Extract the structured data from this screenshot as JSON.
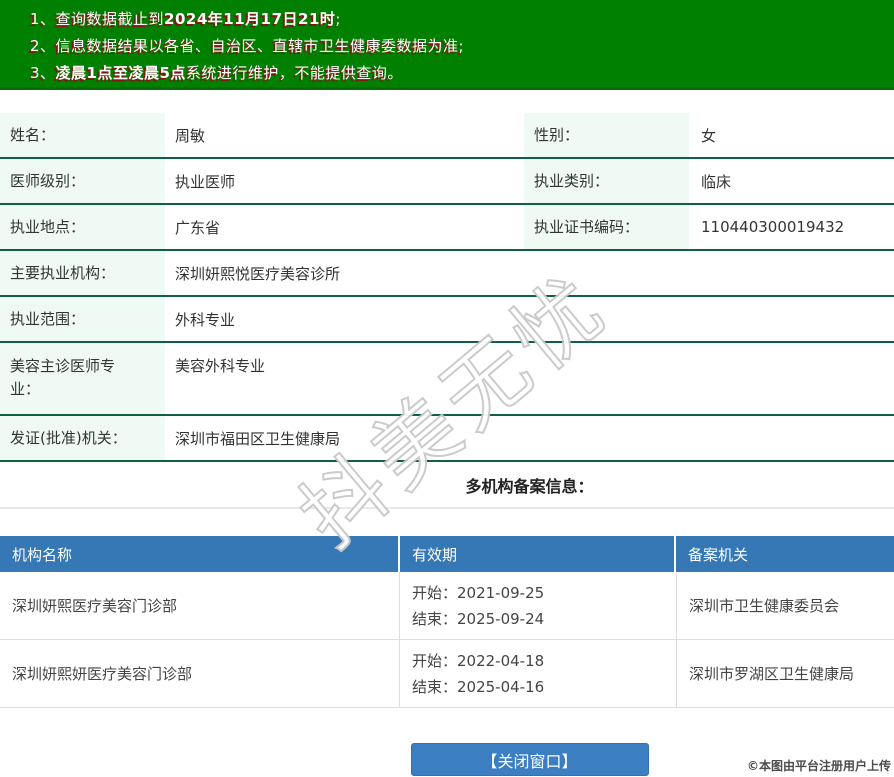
{
  "banner": {
    "bg_color": "#008000",
    "text_color": "#ffffff",
    "shadow_color": "#7b1a0e",
    "notices": [
      {
        "pre": "1、查询数据截止到",
        "bold": "2024年11月17日21时",
        "post": ";"
      },
      {
        "pre": "2、信息数据结果以各省、自治区、直辖市卫生健康委数据为准;",
        "bold": "",
        "post": ""
      },
      {
        "pre": "3、",
        "bold": "凌晨1点至凌晨5点",
        "post": "系统进行维护，不能提供查询。"
      }
    ]
  },
  "profile": {
    "name_label": "姓名：",
    "name_value": "周敏",
    "gender_label": "性别：",
    "gender_value": "女",
    "level_label": "医师级别：",
    "level_value": "执业医师",
    "category_label": "执业类别：",
    "category_value": "临床",
    "location_label": "执业地点：",
    "location_value": "广东省",
    "cert_label": "执业证书编码：",
    "cert_value": "110440300019432",
    "org_label": "主要执业机构：",
    "org_value": "深圳妍熙悦医疗美容诊所",
    "scope_label": "执业范围：",
    "scope_value": "外科专业",
    "cosmetic_label": "美容主诊医师专业：",
    "cosmetic_value": "美容外科专业",
    "issuer_label": "发证(批准)机关：",
    "issuer_value": "深圳市福田区卫生健康局"
  },
  "section_title": "多机构备案信息：",
  "org_table": {
    "header_bg": "#3578b5",
    "headers": [
      "机构名称",
      "有效期",
      "备案机关"
    ],
    "rows": [
      {
        "name": "深圳妍熙医疗美容门诊部",
        "start_text": "开始：2021-09-25",
        "end_text": "结束：2025-09-24",
        "authority": "深圳市卫生健康委员会"
      },
      {
        "name": "深圳妍熙妍医疗美容门诊部",
        "start_text": "开始：2022-04-18",
        "end_text": "结束：2025-04-16",
        "authority": "深圳市罗湖区卫生健康局"
      }
    ]
  },
  "close_button_label": "【关闭窗口】",
  "watermark_text": "抖美无忧",
  "upload_note": "©本图由平台注册用户上传",
  "colors": {
    "row_separator_green": "#0e6146",
    "label_cell_bg": "#eefaf3",
    "table_header_blue": "#3578b5",
    "button_blue": "#3b7ec2"
  }
}
